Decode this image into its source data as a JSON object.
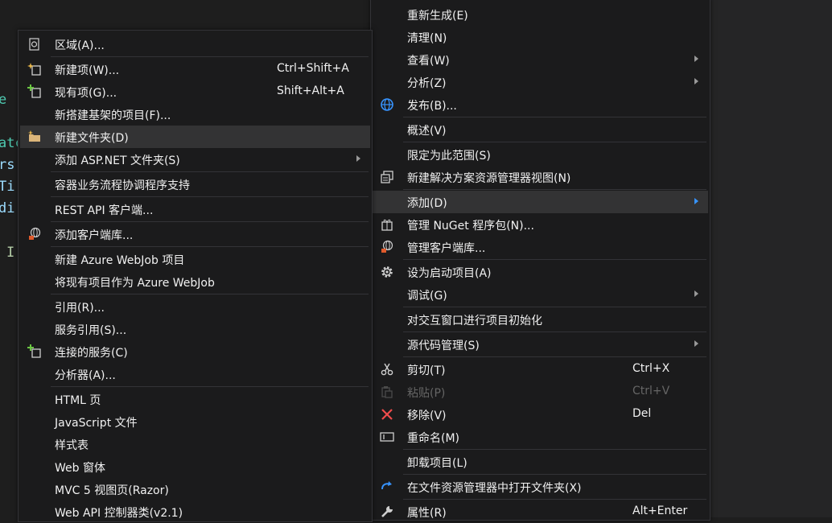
{
  "editor": {
    "fragments": [
      "e",
      "atc",
      "rs",
      "Ti",
      "di",
      "I"
    ]
  },
  "left_menu": {
    "items": [
      {
        "label": "区域(A)...",
        "shortcut": "",
        "icon": "region-icon"
      },
      {
        "label": "新建项(W)...",
        "shortcut": "Ctrl+Shift+A",
        "icon": "new-item-icon"
      },
      {
        "label": "现有项(G)...",
        "shortcut": "Shift+Alt+A",
        "icon": "existing-item-icon"
      },
      {
        "label": "新搭建基架的项目(F)...",
        "shortcut": "",
        "icon": ""
      },
      {
        "label": "新建文件夹(D)",
        "shortcut": "",
        "icon": "new-folder-icon"
      },
      {
        "label": "添加 ASP.NET 文件夹(S)",
        "shortcut": "",
        "icon": ""
      },
      {
        "label": "容器业务流程协调程序支持",
        "shortcut": "",
        "icon": ""
      },
      {
        "label": "REST API 客户端...",
        "shortcut": "",
        "icon": ""
      },
      {
        "label": "添加客户端库...",
        "shortcut": "",
        "icon": "client-library-icon"
      },
      {
        "label": "新建 Azure WebJob 项目",
        "shortcut": "",
        "icon": ""
      },
      {
        "label": "将现有项目作为 Azure WebJob",
        "shortcut": "",
        "icon": ""
      },
      {
        "label": "引用(R)...",
        "shortcut": "",
        "icon": ""
      },
      {
        "label": "服务引用(S)...",
        "shortcut": "",
        "icon": ""
      },
      {
        "label": "连接的服务(C)",
        "shortcut": "",
        "icon": "connected-service-icon"
      },
      {
        "label": "分析器(A)...",
        "shortcut": "",
        "icon": ""
      },
      {
        "label": "HTML 页",
        "shortcut": "",
        "icon": ""
      },
      {
        "label": "JavaScript 文件",
        "shortcut": "",
        "icon": ""
      },
      {
        "label": "样式表",
        "shortcut": "",
        "icon": ""
      },
      {
        "label": "Web 窗体",
        "shortcut": "",
        "icon": ""
      },
      {
        "label": "MVC 5 视图页(Razor)",
        "shortcut": "",
        "icon": ""
      },
      {
        "label": "Web API 控制器类(v2.1)",
        "shortcut": "",
        "icon": ""
      }
    ]
  },
  "right_menu": {
    "items": [
      {
        "label": "重新生成(E)",
        "shortcut": ""
      },
      {
        "label": "清理(N)",
        "shortcut": ""
      },
      {
        "label": "查看(W)",
        "shortcut": ""
      },
      {
        "label": "分析(Z)",
        "shortcut": ""
      },
      {
        "label": "发布(B)...",
        "shortcut": "",
        "icon": "publish-globe-icon"
      },
      {
        "label": "概述(V)",
        "shortcut": ""
      },
      {
        "label": "限定为此范围(S)",
        "shortcut": ""
      },
      {
        "label": "新建解决方案资源管理器视图(N)",
        "shortcut": "",
        "icon": "new-view-icon"
      },
      {
        "label": "添加(D)",
        "shortcut": ""
      },
      {
        "label": "管理 NuGet 程序包(N)...",
        "shortcut": "",
        "icon": "nuget-package-icon"
      },
      {
        "label": "管理客户端库...",
        "shortcut": "",
        "icon": "client-library-icon"
      },
      {
        "label": "设为启动项目(A)",
        "shortcut": "",
        "icon": "gear-icon"
      },
      {
        "label": "调试(G)",
        "shortcut": ""
      },
      {
        "label": "对交互窗口进行项目初始化",
        "shortcut": ""
      },
      {
        "label": "源代码管理(S)",
        "shortcut": ""
      },
      {
        "label": "剪切(T)",
        "shortcut": "Ctrl+X",
        "icon": "scissors-icon"
      },
      {
        "label": "粘贴(P)",
        "shortcut": "Ctrl+V",
        "icon": "paste-icon"
      },
      {
        "label": "移除(V)",
        "shortcut": "Del",
        "icon": "remove-x-icon"
      },
      {
        "label": "重命名(M)",
        "shortcut": "",
        "icon": "rename-icon"
      },
      {
        "label": "卸载项目(L)",
        "shortcut": ""
      },
      {
        "label": "在文件资源管理器中打开文件夹(X)",
        "shortcut": "",
        "icon": "open-folder-refresh-icon"
      },
      {
        "label": "属性(R)",
        "shortcut": "Alt+Enter",
        "icon": "wrench-icon"
      }
    ]
  },
  "colors": {
    "menu_bg": "#1b1b1c",
    "highlight": "#333334",
    "text": "#f1f1f1",
    "disabled": "#656565",
    "separator": "#333337",
    "accent_blue": "#3794ff",
    "code_teal": "#4ec9b0",
    "code_cyan": "#9cdcfe",
    "code_green": "#b5cea8"
  }
}
